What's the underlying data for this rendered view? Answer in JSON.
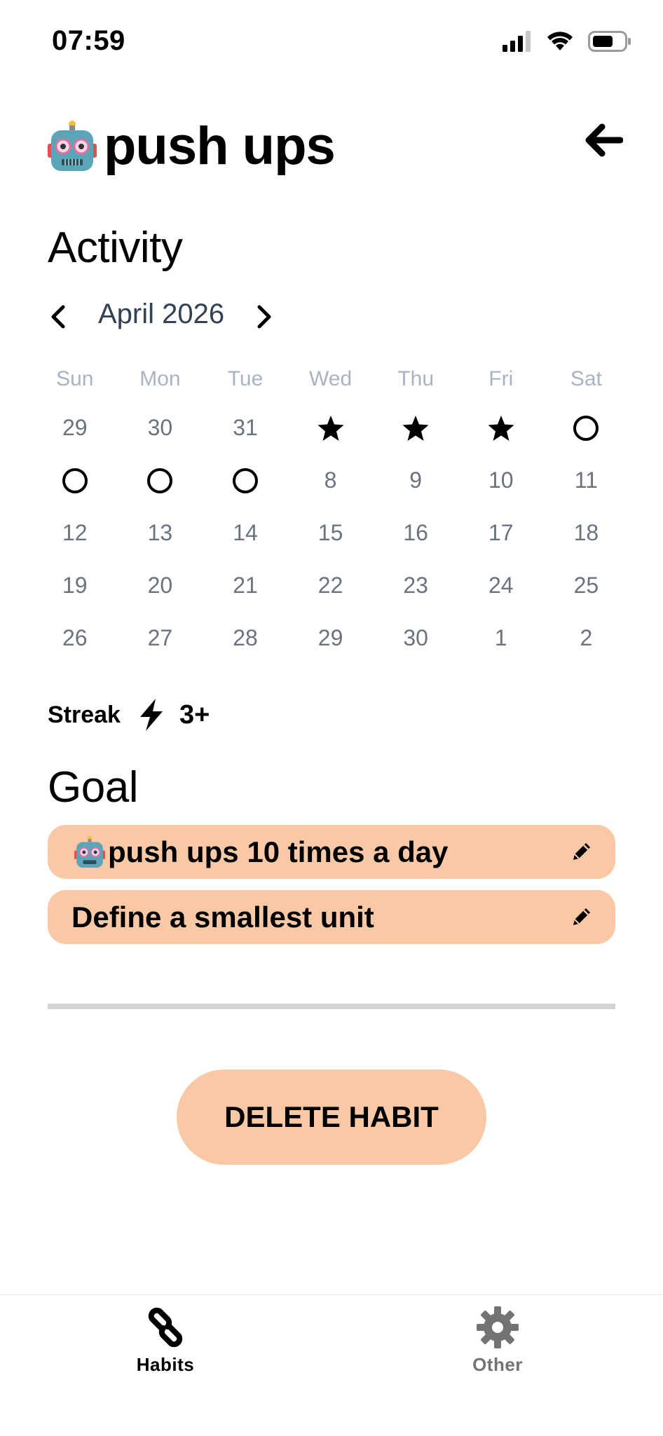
{
  "status_bar": {
    "time": "07:59"
  },
  "header": {
    "emoji": "robot-icon",
    "title": "push ups"
  },
  "activity": {
    "title": "Activity",
    "month_label": "April 2026",
    "weekdays": [
      "Sun",
      "Mon",
      "Tue",
      "Wed",
      "Thu",
      "Fri",
      "Sat"
    ],
    "weeks": [
      [
        "29",
        "30",
        "31",
        "★",
        "★",
        "★",
        "○"
      ],
      [
        "○",
        "○",
        "○",
        "8",
        "9",
        "10",
        "11"
      ],
      [
        "12",
        "13",
        "14",
        "15",
        "16",
        "17",
        "18"
      ],
      [
        "19",
        "20",
        "21",
        "22",
        "23",
        "24",
        "25"
      ],
      [
        "26",
        "27",
        "28",
        "29",
        "30",
        "1",
        "2"
      ]
    ]
  },
  "streak": {
    "label": "Streak",
    "value": "3+"
  },
  "goal": {
    "title": "Goal",
    "items": [
      {
        "text": "push ups 10 times a day",
        "has_emoji": true
      },
      {
        "text": "Define a smallest unit",
        "has_emoji": false
      }
    ]
  },
  "delete_button": "DELETE HABIT",
  "tabs": [
    {
      "label": "Habits",
      "icon": "chain-link-icon",
      "active": true
    },
    {
      "label": "Other",
      "icon": "gear-icon",
      "active": false
    }
  ],
  "colors": {
    "accent": "#f9c9a5",
    "inactive": "#737373",
    "divider": "#d4d4d4"
  }
}
